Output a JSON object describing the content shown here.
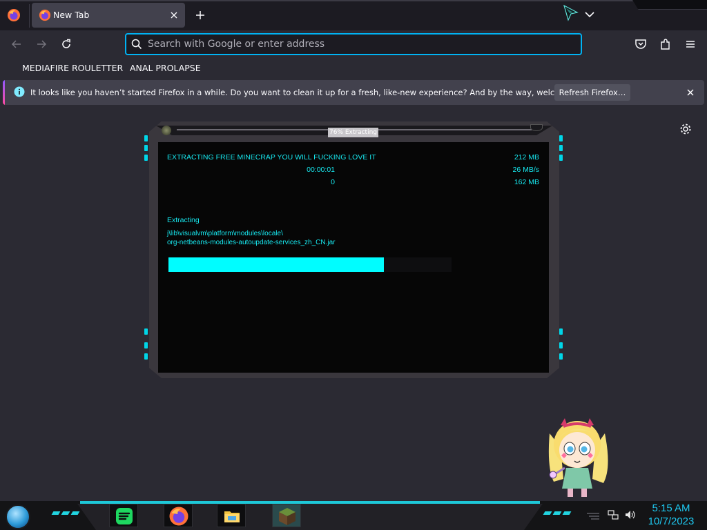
{
  "browser": {
    "tab": {
      "title": "New Tab"
    },
    "urlbar": {
      "placeholder": "Search with Google or enter address"
    },
    "bookmarks": [
      "MEDIAFIRE ROULETTER",
      "ANAL PROLAPSE"
    ],
    "notification": {
      "message": "It looks like you haven’t started Firefox in a while. Do you want to clean it up for a fresh, like-new experience? And by the way, welcome back!",
      "button_label": "Refresh Firefox…"
    }
  },
  "extractor": {
    "title": "76% Extracting",
    "heading": "EXTRACTING FREE MINECRAP YOU WILL FUCKING LOVE IT",
    "elapsed": "00:00:01",
    "count": "0",
    "size_total": "212 MB",
    "speed": "26 MB/s",
    "size_done": "162 MB",
    "status": "Extracting",
    "path_line1": "j\\lib\\visualvm\\platform\\modules\\locale\\",
    "path_line2": "org-netbeans-modules-autoupdate-services_zh_CN.jar",
    "progress_fraction": 0.76,
    "accent_color": "#00fdff"
  },
  "taskbar": {
    "apps": [
      "spotify-icon",
      "firefox-icon",
      "file-explorer-icon",
      "minecraft-icon"
    ],
    "clock": {
      "time": "5:15 AM",
      "date": "10/7/2023"
    }
  },
  "colors": {
    "urlbar_focus": "#00b3f4",
    "frame_background": "#1c1b22",
    "toolbar_background": "#2b2a33",
    "cyan": "#17e9f0"
  }
}
